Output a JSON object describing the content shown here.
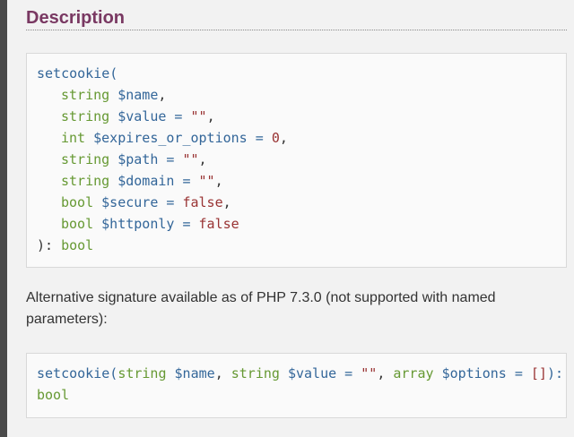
{
  "section": {
    "title": "Description"
  },
  "signature": {
    "function_name": "setcookie(",
    "params": [
      {
        "type": "string",
        "name": "$name",
        "default": null,
        "sep": ","
      },
      {
        "type": "string",
        "name": "$value",
        "default": "\"\"",
        "sep": ","
      },
      {
        "type": "int",
        "name": "$expires_or_options",
        "default": "0",
        "sep": ","
      },
      {
        "type": "string",
        "name": "$path",
        "default": "\"\"",
        "sep": ","
      },
      {
        "type": "string",
        "name": "$domain",
        "default": "\"\"",
        "sep": ","
      },
      {
        "type": "bool",
        "name": "$secure",
        "default": "false",
        "sep": ","
      },
      {
        "type": "bool",
        "name": "$httponly",
        "default": "false",
        "sep": ""
      }
    ],
    "close": "): ",
    "return_type": "bool"
  },
  "alternative": {
    "text": "Alternative signature available as of PHP 7.3.0 (not supported with named parameters):"
  },
  "alt_signature": {
    "function_name": "setcookie(",
    "p1_type": "string",
    "p1_name": "$name",
    "p2_type": "string",
    "p2_name": "$value",
    "p2_default": "\"\"",
    "p3_type": "array",
    "p3_name": "$options",
    "p3_default": "[]",
    "close": "):",
    "return_type": "bool"
  },
  "colors": {
    "heading": "#793862",
    "type": "#669933",
    "variable": "#336699",
    "literal": "#993333"
  }
}
